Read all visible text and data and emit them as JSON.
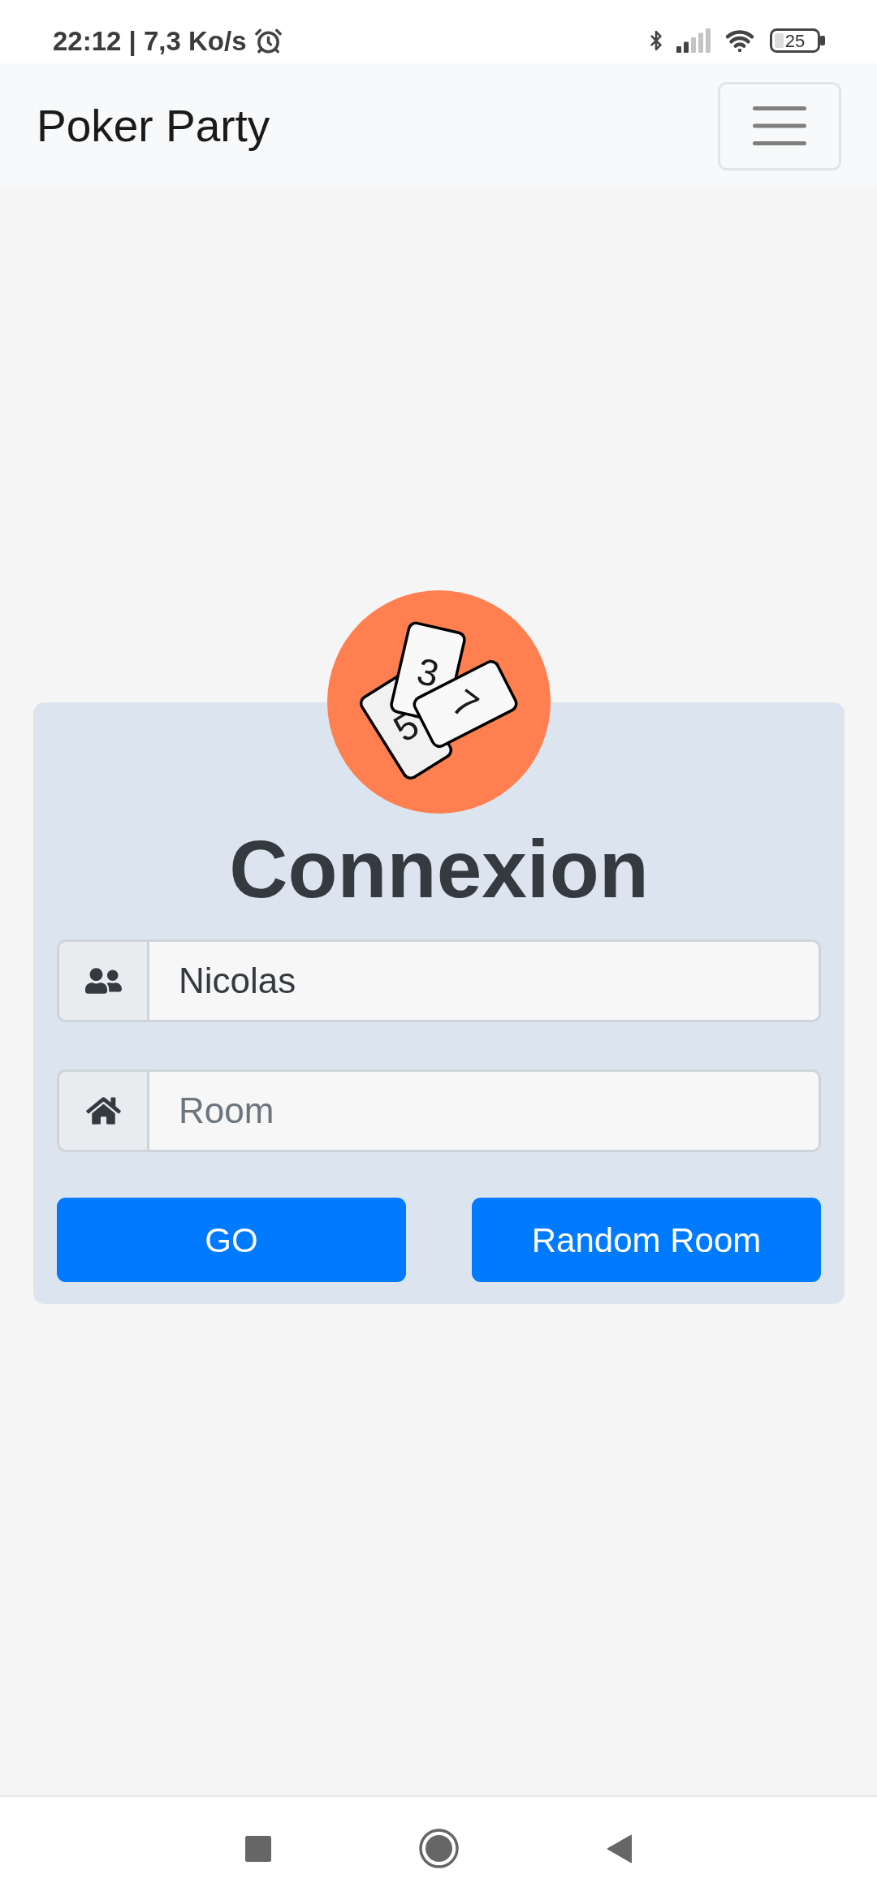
{
  "status_bar": {
    "text": "22:12 | 7,3 Ko/s",
    "battery": "25"
  },
  "navbar": {
    "brand": "Poker Party"
  },
  "logo": {
    "cards": [
      {
        "label": "5"
      },
      {
        "label": "3"
      },
      {
        "label": "7"
      }
    ]
  },
  "login": {
    "title": "Connexion",
    "fields": [
      {
        "kind": "name",
        "value": "Nicolas"
      },
      {
        "kind": "room",
        "placeholder": "Room"
      }
    ],
    "buttons": [
      "GO",
      "Random Room"
    ]
  }
}
